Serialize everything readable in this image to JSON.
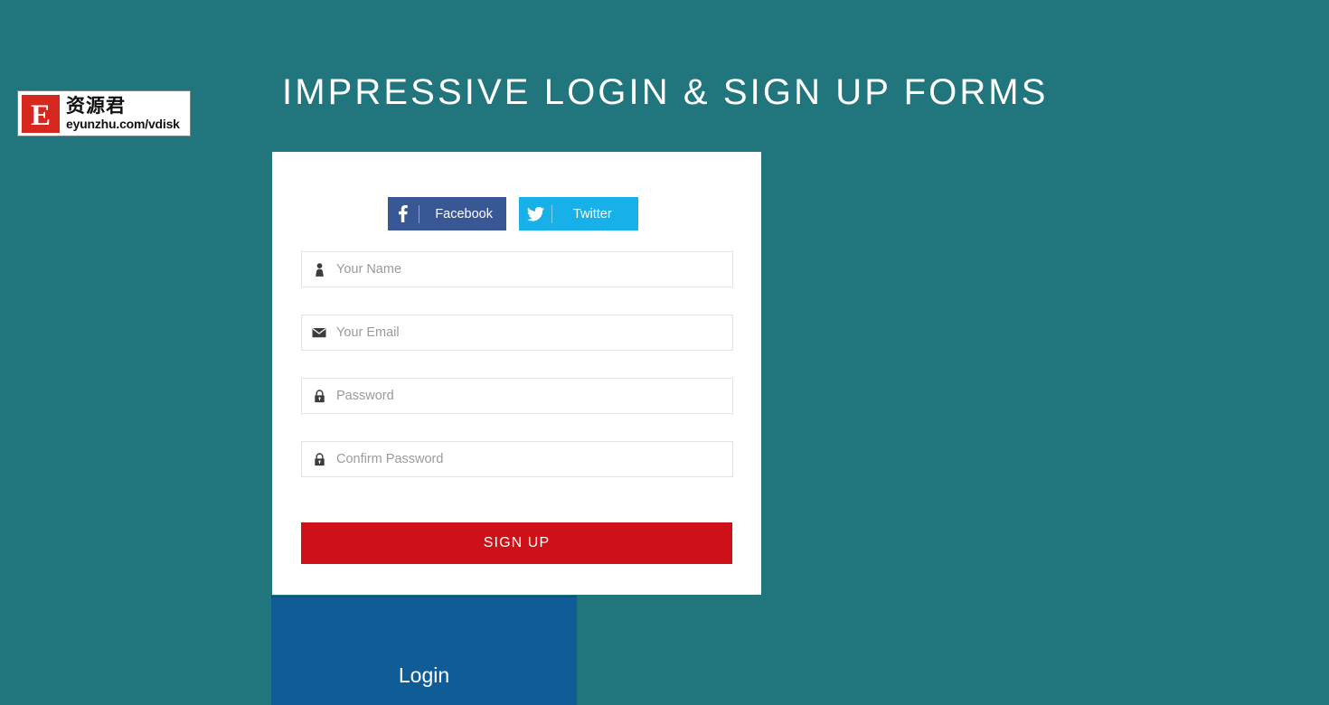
{
  "page": {
    "title": "IMPRESSIVE LOGIN & SIGN UP FORMS",
    "background_color": "#21757c"
  },
  "logo": {
    "mark_letter": "E",
    "cn_text": "资源君",
    "url_text": "eyunzhu.com/vdisk",
    "mark_color": "#d6281f"
  },
  "social": {
    "facebook": {
      "label": "Facebook",
      "icon": "facebook-icon",
      "glyph": "f",
      "color": "#3a5795"
    },
    "twitter": {
      "label": "Twitter",
      "icon": "twitter-icon",
      "glyph": "🐦",
      "color": "#18b0e8"
    }
  },
  "form": {
    "fields": [
      {
        "name": "your-name",
        "icon": "user-icon",
        "placeholder": "Your Name",
        "value": ""
      },
      {
        "name": "your-email",
        "icon": "envelope-icon",
        "placeholder": "Your Email",
        "value": ""
      },
      {
        "name": "password",
        "icon": "lock-icon",
        "placeholder": "Password",
        "value": ""
      },
      {
        "name": "confirm-password",
        "icon": "lock-icon",
        "placeholder": "Confirm Password",
        "value": ""
      }
    ],
    "submit_label": "SIGN UP",
    "submit_color": "#ce1119"
  },
  "login_panel": {
    "title": "Login",
    "color": "#0f5c96"
  }
}
